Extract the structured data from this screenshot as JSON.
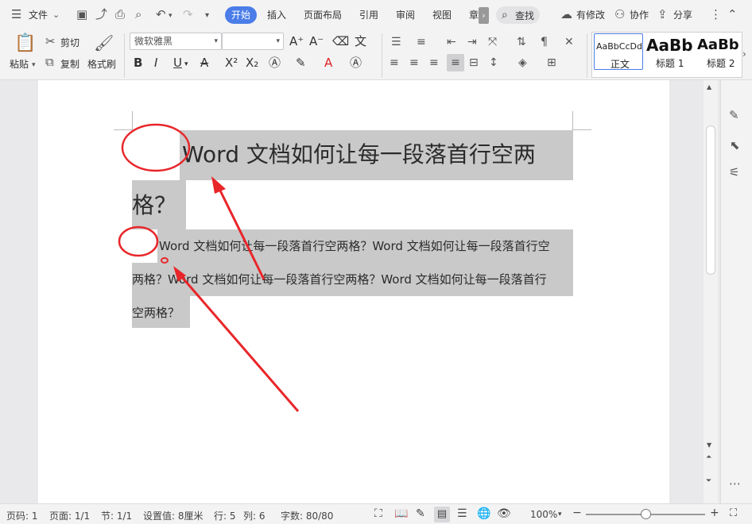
{
  "menubar": {
    "file": "文件",
    "tabs": [
      "开始",
      "插入",
      "页面布局",
      "引用",
      "审阅",
      "视图",
      "章"
    ],
    "search": "查找",
    "has_changes": "有修改",
    "collab": "协作",
    "share": "分享"
  },
  "toolbar": {
    "paste": "粘贴",
    "cut": "剪切",
    "copy": "复制",
    "format_painter": "格式刷",
    "font_name": "微软雅黑",
    "font_size": "",
    "styles": [
      {
        "preview": "AaBbCcDd",
        "label": "正文"
      },
      {
        "preview": "AaBb",
        "label": "标题 1"
      },
      {
        "preview": "AaBb",
        "label": "标题 2"
      }
    ]
  },
  "document": {
    "title_line1": "Word 文档如何让每一段落首行空两",
    "title_line2": "格？",
    "body_line1": "Word 文档如何让每一段落首行空两格？Word 文档如何让每一段落首行空",
    "body_line2": "两格？Word 文档如何让每一段落首行空两格？Word 文档如何让每一段落首行",
    "body_line3": "空两格？",
    "annotation_color": "#e8262a",
    "highlight_color": "#c9c9c9"
  },
  "status": {
    "page_no": "页码: 1",
    "pages": "页面: 1/1",
    "section": "节: 1/1",
    "setting": "设置值: 8厘米",
    "row": "行: 5",
    "col": "列: 6",
    "words": "字数: 80/80",
    "zoom": "100%"
  },
  "accent_color": "#4a7de8"
}
